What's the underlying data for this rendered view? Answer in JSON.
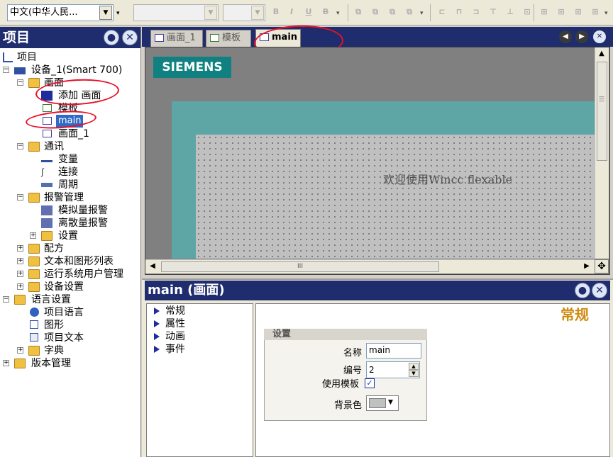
{
  "toolbar": {
    "language_value": "中文(中华人民...",
    "font_value": "",
    "size_value": "",
    "format_icons": [
      "bold-icon",
      "italic-icon",
      "underline-icon",
      "strikethrough-icon"
    ],
    "align_icons": [
      "align-left-icon",
      "align-center-icon",
      "align-right-icon",
      "align-top-icon",
      "align-middle-icon",
      "align-bottom-icon"
    ]
  },
  "project_panel": {
    "title": "项目",
    "tree": {
      "root": "项目",
      "device": "设备_1(Smart 700)",
      "screens_folder": "画面",
      "add_screen": "添加 画面",
      "template": "模板",
      "main": "main",
      "screen_1": "画面_1",
      "comm_folder": "通讯",
      "tags": "变量",
      "connections": "连接",
      "cycles": "周期",
      "alarm_folder": "报警管理",
      "analog_alarms": "模拟量报警",
      "discrete_alarms": "离散量报警",
      "alarm_settings": "设置",
      "recipes": "配方",
      "text_graphic_lists": "文本和图形列表",
      "runtime_users": "运行系统用户管理",
      "device_settings": "设备设置",
      "language_folder": "语言设置",
      "project_languages": "项目语言",
      "graphics": "图形",
      "project_texts": "项目文本",
      "dictionaries": "字典",
      "version_mgmt": "版本管理"
    }
  },
  "editor": {
    "tabs": [
      "画面_1",
      "模板",
      "main"
    ],
    "active_tab": "main",
    "brand": "SIEMENS",
    "welcome_text": "欢迎使用Wincc flexable",
    "hscroll_grip": "III"
  },
  "properties": {
    "title": "main (画面)",
    "categories": [
      "常规",
      "属性",
      "动画",
      "事件"
    ],
    "section_title": "常规",
    "group_title": "设置",
    "name_label": "名称",
    "name_value": "main",
    "number_label": "编号",
    "number_value": "2",
    "use_template_label": "使用模板",
    "use_template_checked": true,
    "background_label": "背景色",
    "background_color": "#c0c0c0"
  },
  "colors": {
    "header_blue": "#1f2c6e",
    "screen_teal": "#5ea6a6",
    "annotation_red": "#e8102a",
    "accent_orange": "#d08a10"
  }
}
